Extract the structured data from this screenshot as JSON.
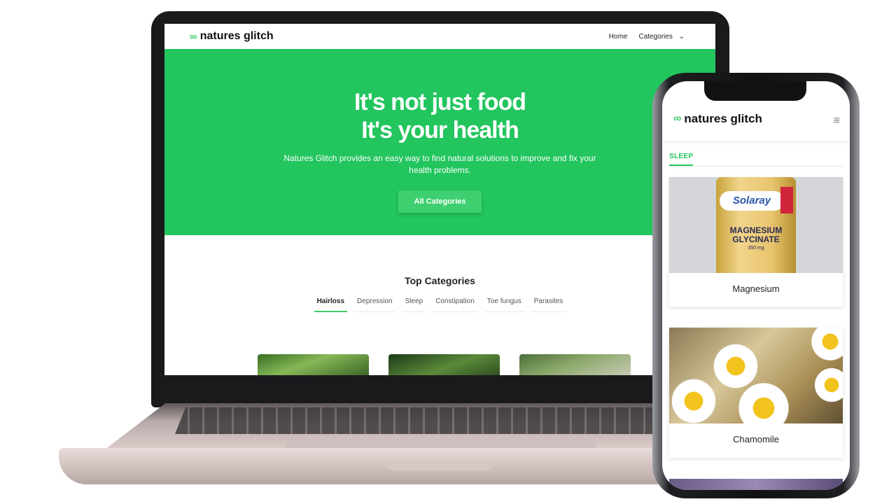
{
  "laptop": {
    "logo_mark": "∞",
    "logo_text": "natures glitch",
    "nav": {
      "home": "Home",
      "categories": "Categories",
      "chevron": "⌄"
    },
    "hero": {
      "title_line1": "It's not just food",
      "title_line2": "It's your health",
      "description": "Natures Glitch provides an easy way to find natural solutions to improve and fix your health problems.",
      "button": "All Categories"
    },
    "top_categories": {
      "title": "Top Categories",
      "tabs": [
        "Hairloss",
        "Depression",
        "Sleep",
        "Constipation",
        "Toe fungus",
        "Parasites"
      ],
      "active": "Hairloss"
    }
  },
  "phone": {
    "logo_mark": "∞",
    "logo_text": "natures glitch",
    "menu_icon": "≡",
    "section_tab": "SLEEP",
    "products": [
      {
        "name": "Magnesium",
        "image_brand": "Solaray",
        "image_text": "MAGNESIUM GLYCINATE",
        "image_dose": "350 mg"
      },
      {
        "name": "Chamomile"
      }
    ]
  },
  "colors": {
    "accent": "#22c55e",
    "logo_green": "#3fcf6c"
  }
}
